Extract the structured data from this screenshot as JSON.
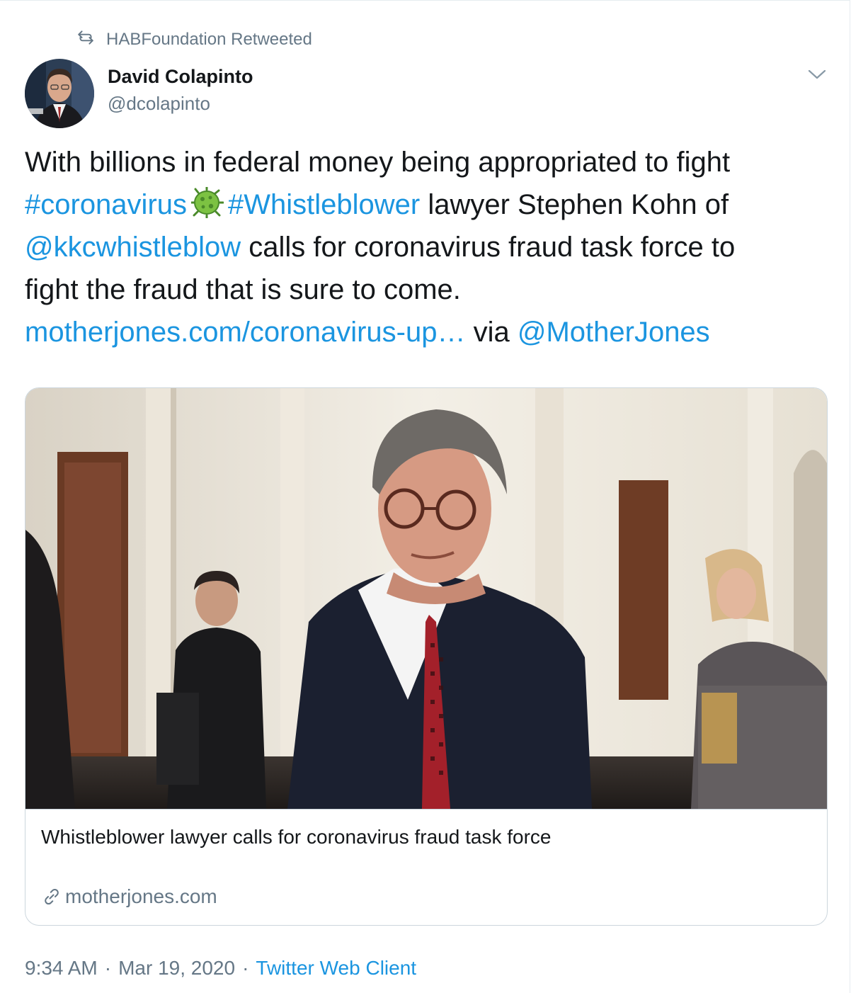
{
  "retweet": {
    "label": "HABFoundation Retweeted"
  },
  "author": {
    "name": "David Colapinto",
    "handle": "@dcolapinto",
    "avatar_caption": "Colapinto"
  },
  "tweet": {
    "line1": "With billions in federal money being appropriated to fight",
    "hashtag1": "#coronavirus",
    "emoji": "microbe",
    "hashtag2": "#Whistleblower",
    "text2": " lawyer Stephen Kohn of",
    "mention1": "@kkcwhistleblow",
    "text3": " calls for coronavirus fraud task force to",
    "line4": "fight the fraud that is sure to come.",
    "url": "motherjones.com/coronavirus-up…",
    "via": " via ",
    "mention2": "@MotherJones"
  },
  "card": {
    "title": "Whistleblower lawyer calls for coronavirus fraud task force",
    "domain": "motherjones.com",
    "icon": "link-icon"
  },
  "meta": {
    "time": "9:34 AM",
    "separator": "·",
    "date": "Mar 19, 2020",
    "source": "Twitter Web Client"
  },
  "colors": {
    "link": "#1b95e0",
    "muted": "#657786",
    "text": "#14171a",
    "border": "#ccd6dd"
  }
}
